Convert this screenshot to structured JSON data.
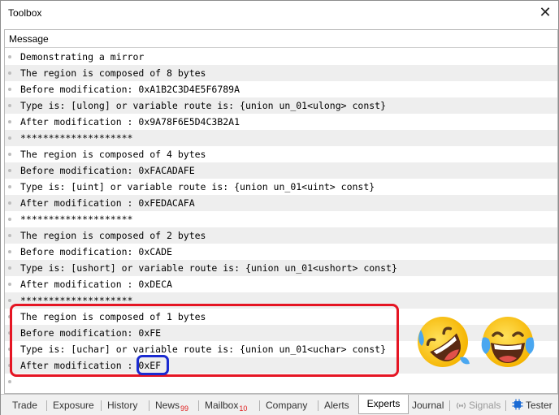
{
  "window": {
    "title": "Toolbox",
    "close_glyph": "✕"
  },
  "log": {
    "column_header": "Message",
    "rows": [
      "Demonstrating a mirror",
      "The region is composed of 8 bytes",
      "Before modification: 0xA1B2C3D4E5F6789A",
      "Type is: [ulong] or variable route is: {union un_01<ulong> const}",
      "After modification : 0x9A78F6E5D4C3B2A1",
      "********************",
      "The region is composed of 4 bytes",
      "Before modification: 0xFACADAFE",
      "Type is: [uint] or variable route is: {union un_01<uint> const}",
      "After modification : 0xFEDACAFA",
      "********************",
      "The region is composed of 2 bytes",
      "Before modification: 0xCADE",
      "Type is: [ushort] or variable route is: {union un_01<ushort> const}",
      "After modification : 0xDECA",
      "********************",
      "The region is composed of 1 bytes",
      "Before modification: 0xFE",
      "Type is: [uchar] or variable route is: {union un_01<uchar> const}",
      "After modification : 0xEF",
      ""
    ]
  },
  "annotations": {
    "red_box_color": "#e51523",
    "blue_box_color": "#1b2bd1",
    "emojis": [
      "rolling-on-floor-laughing-emoji",
      "face-with-tears-of-joy-emoji"
    ]
  },
  "tabs": [
    {
      "label": "Trade"
    },
    {
      "label": "Exposure"
    },
    {
      "label": "History"
    },
    {
      "label": "News",
      "badge": "99"
    },
    {
      "label": "Mailbox",
      "badge": "10"
    },
    {
      "label": "Company"
    },
    {
      "label": "Alerts"
    },
    {
      "label": "Experts",
      "active": true
    },
    {
      "label": "Journal"
    },
    {
      "label": "Signals",
      "disabled": true,
      "icon": "signal-icon"
    },
    {
      "label": "Tester",
      "icon": "chip-icon"
    }
  ]
}
